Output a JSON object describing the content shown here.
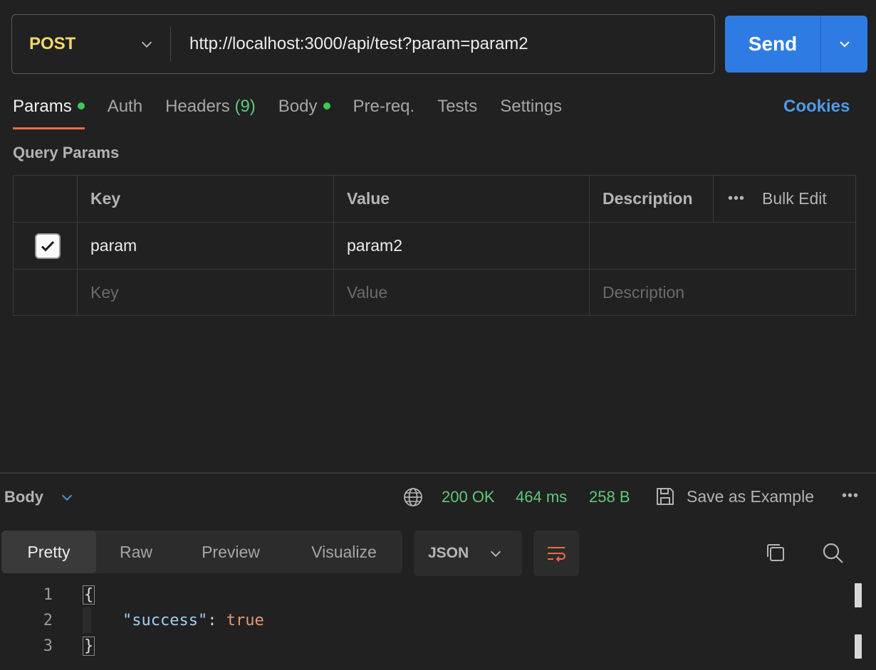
{
  "request": {
    "method": "POST",
    "url": "http://localhost:3000/api/test?param=param2",
    "send_label": "Send"
  },
  "request_tabs": [
    {
      "label": "Params",
      "dot": true
    },
    {
      "label": "Auth"
    },
    {
      "label": "Headers",
      "count": "(9)"
    },
    {
      "label": "Body",
      "dot": true
    },
    {
      "label": "Pre-req."
    },
    {
      "label": "Tests"
    },
    {
      "label": "Settings"
    }
  ],
  "cookies_label": "Cookies",
  "query_params": {
    "title": "Query Params",
    "headers": {
      "key": "Key",
      "value": "Value",
      "description": "Description",
      "more": "•••",
      "bulk_edit": "Bulk Edit"
    },
    "rows": [
      {
        "checked": true,
        "key": "param",
        "value": "param2",
        "description": ""
      }
    ],
    "placeholder": {
      "key": "Key",
      "value": "Value",
      "description": "Description"
    }
  },
  "response": {
    "section_label": "Body",
    "status": "200 OK",
    "time": "464 ms",
    "size": "258 B",
    "save_label": "Save as Example",
    "more": "•••",
    "view_tabs": [
      "Pretty",
      "Raw",
      "Preview",
      "Visualize"
    ],
    "active_view": "Pretty",
    "format": "JSON",
    "lines": [
      {
        "n": "1",
        "text": "{"
      },
      {
        "n": "2",
        "key": "\"success\"",
        "colon": ": ",
        "value": "true"
      },
      {
        "n": "3",
        "text": "}"
      }
    ]
  },
  "colors": {
    "method": "#f5d76e",
    "send": "#2f7be4",
    "active_tab_underline": "#ef6c47",
    "status_green": "#5fc97a",
    "cookies": "#4f9be8"
  }
}
